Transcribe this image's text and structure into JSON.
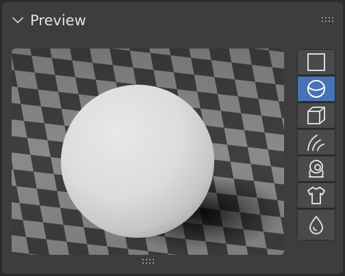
{
  "panel": {
    "title": "Preview"
  },
  "preview": {
    "shape_buttons": [
      {
        "name": "plane",
        "icon": "square-plane-icon",
        "active": false
      },
      {
        "name": "sphere",
        "icon": "sphere-icon",
        "active": true
      },
      {
        "name": "cube",
        "icon": "cube-icon",
        "active": false
      },
      {
        "name": "hair",
        "icon": "hair-strands-icon",
        "active": false
      },
      {
        "name": "monkey",
        "icon": "monkey-head-icon",
        "active": false
      },
      {
        "name": "cloth",
        "icon": "shirt-icon",
        "active": false
      },
      {
        "name": "fluid",
        "icon": "droplet-icon",
        "active": false
      }
    ]
  },
  "colors": {
    "panel_bg": "#3d3d3d",
    "accent_active": "#4772b3",
    "button_bg": "#4a4a4a",
    "text": "#e2e2e2"
  }
}
